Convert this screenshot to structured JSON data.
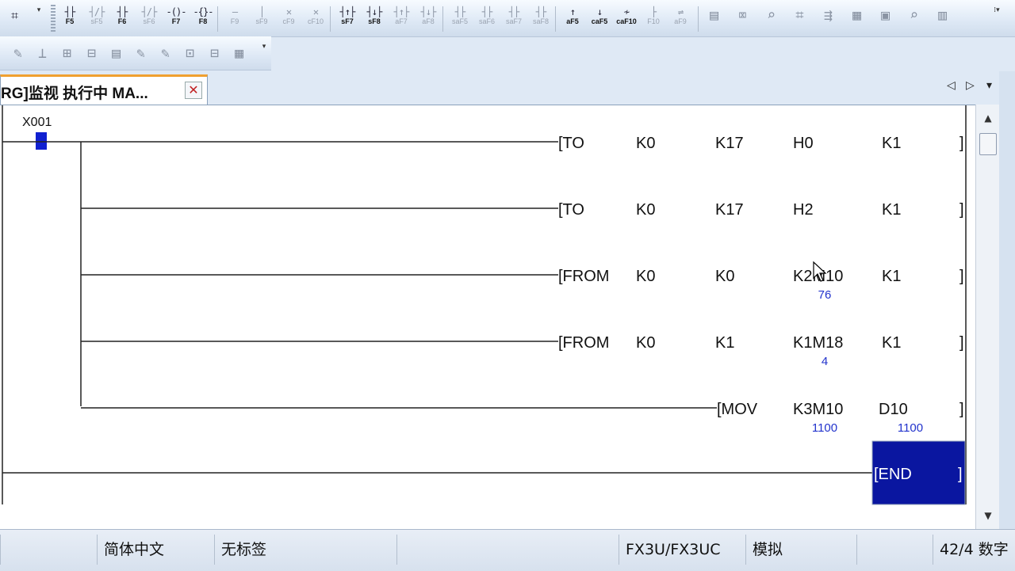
{
  "toolbar_main": {
    "fkeys": [
      {
        "glyph": "┤├",
        "label": "F5",
        "enabled": true
      },
      {
        "glyph": "┤/├",
        "label": "sF5",
        "enabled": false
      },
      {
        "glyph": "┤├",
        "label": "F6",
        "enabled": true
      },
      {
        "glyph": "┤/├",
        "label": "sF6",
        "enabled": false
      },
      {
        "glyph": "-()-",
        "label": "F7",
        "enabled": true
      },
      {
        "glyph": "-{}-",
        "label": "F8",
        "enabled": true
      },
      {
        "glyph": "—",
        "label": "F9",
        "enabled": false
      },
      {
        "glyph": "│",
        "label": "sF9",
        "enabled": false
      },
      {
        "glyph": "✕",
        "label": "cF9",
        "enabled": false
      },
      {
        "glyph": "✕",
        "label": "cF10",
        "enabled": false
      },
      {
        "glyph": "┤↑├",
        "label": "sF7",
        "enabled": true
      },
      {
        "glyph": "┤↓├",
        "label": "sF8",
        "enabled": true
      },
      {
        "glyph": "┤↑├",
        "label": "aF7",
        "enabled": false
      },
      {
        "glyph": "┤↓├",
        "label": "aF8",
        "enabled": false
      },
      {
        "glyph": "┤├",
        "label": "saF5",
        "enabled": false
      },
      {
        "glyph": "┤├",
        "label": "saF6",
        "enabled": false
      },
      {
        "glyph": "┤├",
        "label": "saF7",
        "enabled": false
      },
      {
        "glyph": "┤├",
        "label": "saF8",
        "enabled": false
      },
      {
        "glyph": "↑",
        "label": "aF5",
        "enabled": true
      },
      {
        "glyph": "↓",
        "label": "caF5",
        "enabled": true
      },
      {
        "glyph": "≁",
        "label": "caF10",
        "enabled": true
      },
      {
        "glyph": "├",
        "label": "F10",
        "enabled": false
      },
      {
        "glyph": "⇌",
        "label": "aF9",
        "enabled": false
      }
    ]
  },
  "toolbar_second": {
    "button_count": 10
  },
  "tab": {
    "title": "RG]监视 执行中 MA...",
    "close_symbol": "✕",
    "nav_prev": "◁",
    "nav_next": "▷",
    "nav_menu": "▾"
  },
  "ladder": {
    "contact": {
      "device": "X001"
    },
    "instructions": [
      {
        "operands": [
          "[TO",
          "K0",
          "K17",
          "H0",
          "K1"
        ],
        "monitor": [
          "",
          "",
          "",
          "",
          ""
        ],
        "closing": "]"
      },
      {
        "operands": [
          "[TO",
          "K0",
          "K17",
          "H2",
          "K1"
        ],
        "monitor": [
          "",
          "",
          "",
          "",
          ""
        ],
        "closing": "]"
      },
      {
        "operands": [
          "[FROM",
          "K0",
          "K0",
          "K2M10",
          "K1"
        ],
        "monitor": [
          "",
          "",
          "",
          "76",
          ""
        ],
        "closing": "]"
      },
      {
        "operands": [
          "[FROM",
          "K0",
          "K1",
          "K1M18",
          "K1"
        ],
        "monitor": [
          "",
          "",
          "",
          "4",
          ""
        ],
        "closing": "]"
      },
      {
        "operands": [
          "[MOV",
          "K3M10",
          "D10"
        ],
        "monitor": [
          "",
          "1100",
          "1100"
        ],
        "closing": "]"
      }
    ],
    "end": {
      "label": "[END",
      "closing": "]"
    }
  },
  "scrollbar": {
    "up": "▲",
    "down": "▼"
  },
  "statusbar": {
    "cells": [
      "",
      "简体中文",
      "无标签",
      "",
      "FX3U/FX3UC",
      "模拟",
      "",
      "42/4 数字"
    ]
  },
  "colors": {
    "end_block": "#0a16a0",
    "contact_on": "#1020d0",
    "monitor_text": "#2233cc",
    "tab_accent": "#f0a030"
  }
}
